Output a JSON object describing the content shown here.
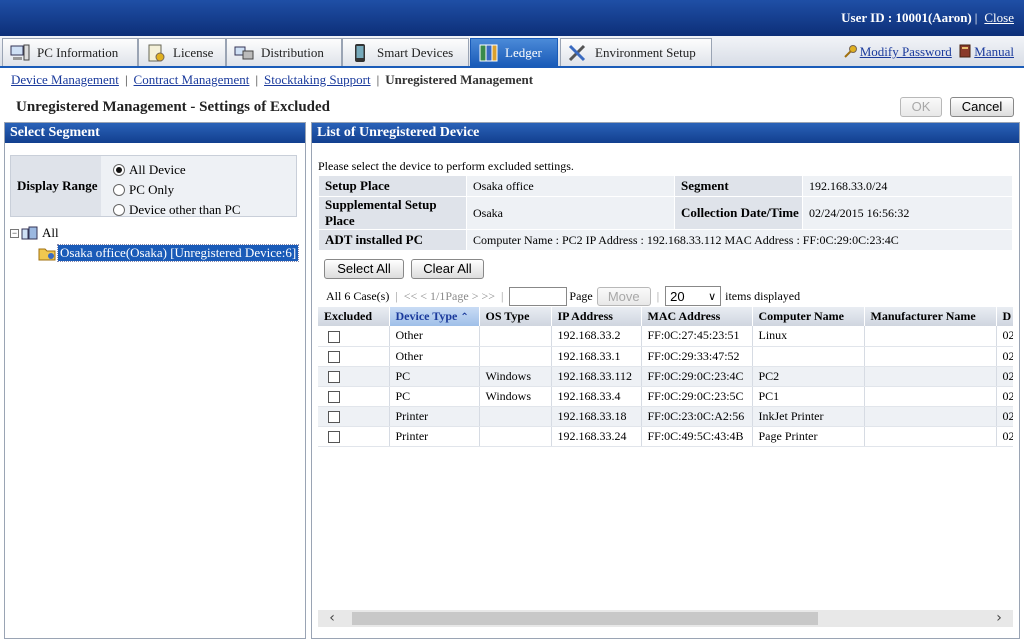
{
  "header": {
    "user_label": "User ID : 10001(Aaron)",
    "close": "Close"
  },
  "tabs": [
    {
      "label": "PC Information",
      "icon": "pc-icon"
    },
    {
      "label": "License",
      "icon": "license-icon"
    },
    {
      "label": "Distribution",
      "icon": "distribution-icon"
    },
    {
      "label": "Smart Devices",
      "icon": "smartphone-icon"
    },
    {
      "label": "Ledger",
      "icon": "ledger-icon"
    },
    {
      "label": "Environment Setup",
      "icon": "tools-icon"
    }
  ],
  "toplinks": {
    "modify_password": "Modify Password",
    "manual": "Manual"
  },
  "subnav": {
    "device_management": "Device Management",
    "contract_management": "Contract Management",
    "stocktaking_support": "Stocktaking Support",
    "current": "Unregistered Management"
  },
  "page": {
    "title": "Unregistered Management - Settings of Excluded",
    "ok": "OK",
    "cancel": "Cancel"
  },
  "left": {
    "title": "Select Segment",
    "display_range_label": "Display Range",
    "options": [
      "All Device",
      "PC Only",
      "Device other than PC"
    ],
    "tree_root": "All",
    "tree_child": "Osaka office(Osaka) [Unregistered Device:6]"
  },
  "right": {
    "title": "List of Unregistered Device",
    "note": "Please select the device to perform excluded settings.",
    "info": {
      "setup_place_label": "Setup Place",
      "setup_place": "Osaka office",
      "segment_label": "Segment",
      "segment": "192.168.33.0/24",
      "supp_label": "Supplemental Setup Place",
      "supp": "Osaka",
      "collection_label": "Collection Date/Time",
      "collection": "02/24/2015 16:56:32",
      "adt_label": "ADT installed PC",
      "adt": "Computer Name : PC2   IP Address : 192.168.33.112   MAC Address : FF:0C:29:0C:23:4C"
    },
    "select_all": "Select All",
    "clear_all": "Clear All",
    "pager": {
      "count": "All 6 Case(s)",
      "nav": "<< < 1/1Page > >>",
      "page": "Page",
      "move": "Move",
      "per_page": "20",
      "items_displayed": "items displayed"
    },
    "columns": [
      "Excluded",
      "Device Type",
      "OS Type",
      "IP Address",
      "MAC Address",
      "Computer Name",
      "Manufacturer Name",
      "D"
    ],
    "rows": [
      {
        "type": "Other",
        "os": "",
        "ip": "192.168.33.2",
        "mac": "FF:0C:27:45:23:51",
        "name": "Linux",
        "mfr": "",
        "d": "02"
      },
      {
        "type": "Other",
        "os": "",
        "ip": "192.168.33.1",
        "mac": "FF:0C:29:33:47:52",
        "name": "",
        "mfr": "",
        "d": "02"
      },
      {
        "type": "PC",
        "os": "Windows",
        "ip": "192.168.33.112",
        "mac": "FF:0C:29:0C:23:4C",
        "name": "PC2",
        "mfr": "",
        "d": "02"
      },
      {
        "type": "PC",
        "os": "Windows",
        "ip": "192.168.33.4",
        "mac": "FF:0C:29:0C:23:5C",
        "name": "PC1",
        "mfr": "",
        "d": "02"
      },
      {
        "type": "Printer",
        "os": "",
        "ip": "192.168.33.18",
        "mac": "FF:0C:23:0C:A2:56",
        "name": "InkJet Printer",
        "mfr": "",
        "d": "02"
      },
      {
        "type": "Printer",
        "os": "",
        "ip": "192.168.33.24",
        "mac": "FF:0C:49:5C:43:4B",
        "name": "Page Printer",
        "mfr": "",
        "d": "02"
      }
    ]
  }
}
